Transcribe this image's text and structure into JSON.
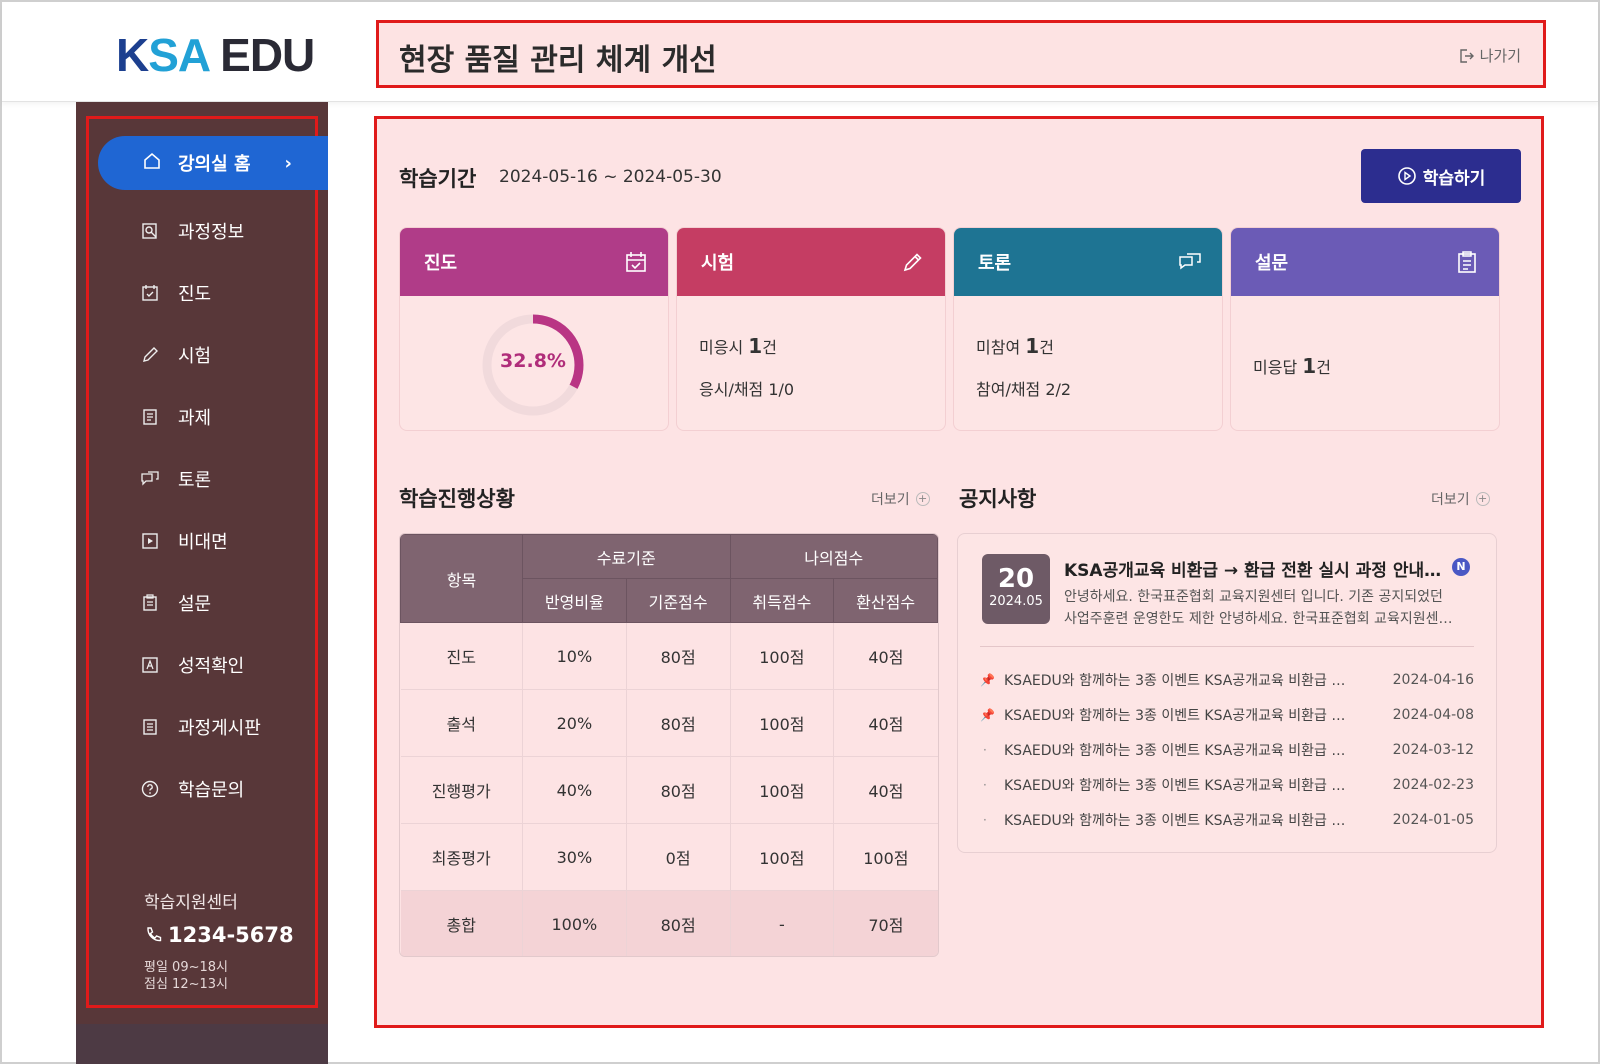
{
  "header": {
    "logo_ksa_k": "K",
    "logo_ksa_sa": "SA",
    "logo_edu": "EDU",
    "title": "현장 품질 관리 체계 개선",
    "exit_label": "나가기"
  },
  "sidebar": {
    "home": {
      "label": "강의실 홈",
      "icon": "home-icon"
    },
    "items": [
      {
        "label": "과정정보",
        "icon": "course-info-icon"
      },
      {
        "label": "진도",
        "icon": "calendar-check-icon"
      },
      {
        "label": "시험",
        "icon": "pencil-icon"
      },
      {
        "label": "과제",
        "icon": "assignment-icon"
      },
      {
        "label": "토론",
        "icon": "chat-icon"
      },
      {
        "label": "비대면",
        "icon": "video-icon"
      },
      {
        "label": "설문",
        "icon": "clipboard-icon"
      },
      {
        "label": "성적확인",
        "icon": "grade-icon"
      },
      {
        "label": "과정게시판",
        "icon": "board-icon"
      },
      {
        "label": "학습문의",
        "icon": "question-icon"
      }
    ],
    "support": {
      "title": "학습지원센터",
      "phone": "1234-5678",
      "hours_weekday": "평일 09~18시",
      "hours_lunch": "점심 12~13시"
    }
  },
  "main": {
    "period_label": "학습기간",
    "period_value": "2024-05-16 ~ 2024-05-30",
    "study_button": "학습하기",
    "cards": {
      "progress": {
        "title": "진도",
        "percent_label": "32.8%",
        "percent": 32.8,
        "color": "#b03c88"
      },
      "exam": {
        "title": "시험",
        "line1_prefix": "미응시",
        "line1_count": "1",
        "line1_suffix": "건",
        "line2": "응시/채점 1/0",
        "color": "#c53d63"
      },
      "discussion": {
        "title": "토론",
        "line1_prefix": "미참여",
        "line1_count": "1",
        "line1_suffix": "건",
        "line2": "참여/채점 2/2",
        "color": "#1e7493"
      },
      "survey": {
        "title": "설문",
        "line1_prefix": "미응답",
        "line1_count": "1",
        "line1_suffix": "건",
        "color": "#6b5bb6"
      }
    },
    "progress_section": {
      "title": "학습진행상황",
      "more": "더보기",
      "headers": {
        "item": "항목",
        "completion": "수료기준",
        "my_score": "나의점수",
        "ratio": "반영비율",
        "base": "기준점수",
        "obtained": "취득점수",
        "converted": "환산점수"
      },
      "rows": [
        [
          "진도",
          "10%",
          "80점",
          "100점",
          "40점"
        ],
        [
          "출석",
          "20%",
          "80점",
          "100점",
          "40점"
        ],
        [
          "진행평가",
          "40%",
          "80점",
          "100점",
          "40점"
        ],
        [
          "최종평가",
          "30%",
          "0점",
          "100점",
          "100점"
        ],
        [
          "총합",
          "100%",
          "80점",
          "-",
          "70점"
        ]
      ]
    },
    "notice_section": {
      "title": "공지사항",
      "more": "더보기",
      "featured": {
        "day": "20",
        "year_month": "2024.05",
        "title": "KSA공개교육 비환급 → 환급 전환 실시 과정 안내(…",
        "badge": "N",
        "body_line1": "안녕하세요. 한국표준협회 교육지원센터 입니다. 기존 공지되었던",
        "body_line2": "사업주훈련 운영한도 제한 안녕하세요. 한국표준협회 교육지원센…"
      },
      "items": [
        {
          "pinned": true,
          "text": "KSAEDU와 함께하는 3종 이벤트 KSA공개교육 비환급 …",
          "date": "2024-04-16"
        },
        {
          "pinned": true,
          "text": "KSAEDU와 함께하는 3종 이벤트 KSA공개교육 비환급 …",
          "date": "2024-04-08"
        },
        {
          "pinned": false,
          "text": "KSAEDU와 함께하는 3종 이벤트 KSA공개교육 비환급 …",
          "date": "2024-03-12"
        },
        {
          "pinned": false,
          "text": "KSAEDU와 함께하는 3종 이벤트 KSA공개교육 비환급 …",
          "date": "2024-02-23"
        },
        {
          "pinned": false,
          "text": "KSAEDU와 함께하는 3종 이벤트 KSA공개교육 비환급 …",
          "date": "2024-01-05"
        }
      ]
    }
  }
}
